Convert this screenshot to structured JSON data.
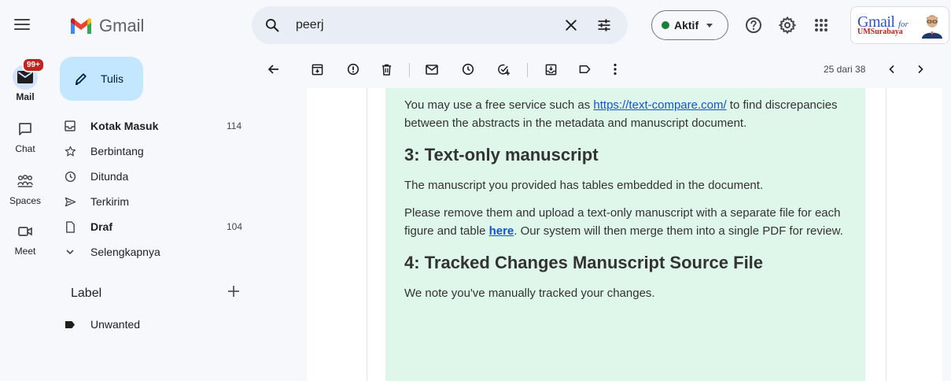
{
  "header": {
    "app_name": "Gmail",
    "search": {
      "value": "peerj"
    },
    "status": {
      "label": "Aktif",
      "color": "#188038"
    },
    "org": {
      "logo_text": "Gmail",
      "logo_for": "for",
      "logo_sub": "UMSurabaya"
    }
  },
  "rail": {
    "items": [
      {
        "label": "Mail",
        "icon": "mail-icon",
        "badge": "99+",
        "active": true
      },
      {
        "label": "Chat",
        "icon": "chat-icon"
      },
      {
        "label": "Spaces",
        "icon": "spaces-icon"
      },
      {
        "label": "Meet",
        "icon": "meet-icon"
      }
    ]
  },
  "compose": {
    "label": "Tulis"
  },
  "nav": {
    "items": [
      {
        "label": "Kotak Masuk",
        "count": "114",
        "icon": "inbox-icon",
        "bold": true
      },
      {
        "label": "Berbintang",
        "count": "",
        "icon": "star-icon"
      },
      {
        "label": "Ditunda",
        "count": "",
        "icon": "clock-icon"
      },
      {
        "label": "Terkirim",
        "count": "",
        "icon": "send-icon"
      },
      {
        "label": "Draf",
        "count": "104",
        "icon": "draft-icon",
        "bold": true
      },
      {
        "label": "Selengkapnya",
        "count": "",
        "icon": "chevron-down-icon"
      }
    ],
    "label_heading": "Label",
    "labels": [
      {
        "label": "Unwanted",
        "icon": "label-icon"
      }
    ]
  },
  "toolbar": {
    "pager": "25 dari 38"
  },
  "message": {
    "p1_before": "You may use a free service such as ",
    "p1_link": "https://text-compare.com/",
    "p1_after": " to find discrepancies between the abstracts in the metadata and manuscript document.",
    "h3": "3: Text-only manuscript",
    "p2": "The manuscript you provided has tables embedded in the document.",
    "p3_before": "Please remove them and upload a text-only manuscript with a separate file for each figure and table ",
    "p3_link": "here",
    "p3_after": ". Our system will then merge them into a single PDF for review.",
    "h4": "4: Tracked Changes Manuscript Source File",
    "p4": "We note you've manually tracked your changes."
  }
}
